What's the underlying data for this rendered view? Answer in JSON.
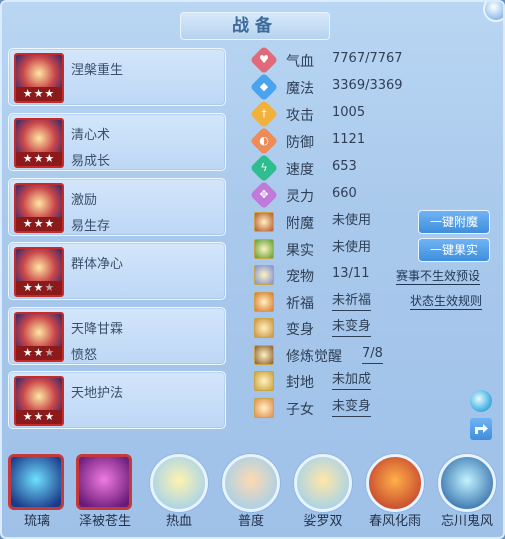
{
  "title": "战备",
  "skills": [
    {
      "name": "涅槃重生",
      "sub": "",
      "stars": "★★★",
      "dim_stars": "",
      "icon": "phoenix-rebirth-icon"
    },
    {
      "name": "清心术",
      "sub": "易成长",
      "stars": "★★★",
      "dim_stars": "",
      "icon": "mind-purify-icon"
    },
    {
      "name": "激励",
      "sub": "易生存",
      "stars": "★★★",
      "dim_stars": "",
      "icon": "inspire-icon"
    },
    {
      "name": "群体净心",
      "sub": "",
      "stars": "★★",
      "dim_stars": "★",
      "icon": "group-purify-icon"
    },
    {
      "name": "天降甘霖",
      "sub": "愤怒",
      "stars": "★★",
      "dim_stars": "★",
      "icon": "heavenly-rain-icon"
    },
    {
      "name": "天地护法",
      "sub": "",
      "stars": "★★★",
      "dim_stars": "",
      "icon": "guardian-icon"
    }
  ],
  "stats": [
    {
      "label": "气血",
      "value": "7767/7767",
      "color": "#e06a7a",
      "glyph": "♥",
      "icon": "hp-icon"
    },
    {
      "label": "魔法",
      "value": "3369/3369",
      "color": "#4aa3ef",
      "glyph": "◆",
      "icon": "mp-icon"
    },
    {
      "label": "攻击",
      "value": "1005",
      "color": "#f2b13a",
      "glyph": "†",
      "icon": "attack-icon"
    },
    {
      "label": "防御",
      "value": "1121",
      "color": "#f08a57",
      "glyph": "◐",
      "icon": "defense-icon"
    },
    {
      "label": "速度",
      "value": "653",
      "color": "#2dbd8f",
      "glyph": "ϟ",
      "icon": "speed-icon"
    },
    {
      "label": "灵力",
      "value": "660",
      "color": "#c07ad9",
      "glyph": "✥",
      "icon": "spirit-icon"
    }
  ],
  "items": [
    {
      "label": "附魔",
      "value": "未使用",
      "underline": false,
      "icon": "enchant-icon",
      "icon_color": "#b5542b"
    },
    {
      "label": "果实",
      "value": "未使用",
      "underline": false,
      "icon": "fruit-icon",
      "icon_color": "#5a9e2f"
    },
    {
      "label": "宠物",
      "value": "13/11",
      "underline": false,
      "icon": "pet-icon",
      "icon_color": "#7d8fd6"
    },
    {
      "label": "祈福",
      "value": "未祈福",
      "underline": true,
      "icon": "blessing-icon",
      "icon_color": "#d9772b"
    },
    {
      "label": "变身",
      "value": "未变身",
      "underline": true,
      "icon": "transform-icon",
      "icon_color": "#c9913a"
    },
    {
      "label": "修炼觉醒",
      "value": "7/8",
      "underline": true,
      "icon": "cultivation-icon",
      "icon_color": "#8a5a2f"
    },
    {
      "label": "封地",
      "value": "未加成",
      "underline": true,
      "icon": "fief-icon",
      "icon_color": "#caa03a"
    },
    {
      "label": "子女",
      "value": "未变身",
      "underline": true,
      "icon": "children-icon",
      "icon_color": "#e38b4f"
    }
  ],
  "buttons": {
    "enchant": "一键附魔",
    "fruit": "一键果实"
  },
  "links": {
    "preset": "赛事不生效预设",
    "rules": "状态生效规则"
  },
  "bottom_skills": [
    {
      "label": "琉璃",
      "shape": "square",
      "icon": "liuli-icon",
      "c1": "#6fe0ff",
      "c2": "#1a3a8a"
    },
    {
      "label": "泽被苍生",
      "shape": "square",
      "icon": "blessing-hand-icon",
      "c1": "#f07be0",
      "c2": "#6a1b7a"
    },
    {
      "label": "热血",
      "shape": "round",
      "icon": "hot-blood-icon",
      "c1": "#fff3b0",
      "c2": "#9fd0ef"
    },
    {
      "label": "普度",
      "shape": "round",
      "icon": "salvation-icon",
      "c1": "#ffd9b0",
      "c2": "#9fd0ef"
    },
    {
      "label": "娑罗双",
      "shape": "round",
      "icon": "sal-tree-icon",
      "c1": "#ffe7a8",
      "c2": "#9fd0ef"
    },
    {
      "label": "春风化雨",
      "shape": "round",
      "icon": "spring-rain-icon",
      "c1": "#ffb04a",
      "c2": "#c2402b"
    },
    {
      "label": "忘川鬼风",
      "shape": "round",
      "icon": "ghost-wind-icon",
      "c1": "#c2f3ff",
      "c2": "#2f6aa8"
    }
  ]
}
